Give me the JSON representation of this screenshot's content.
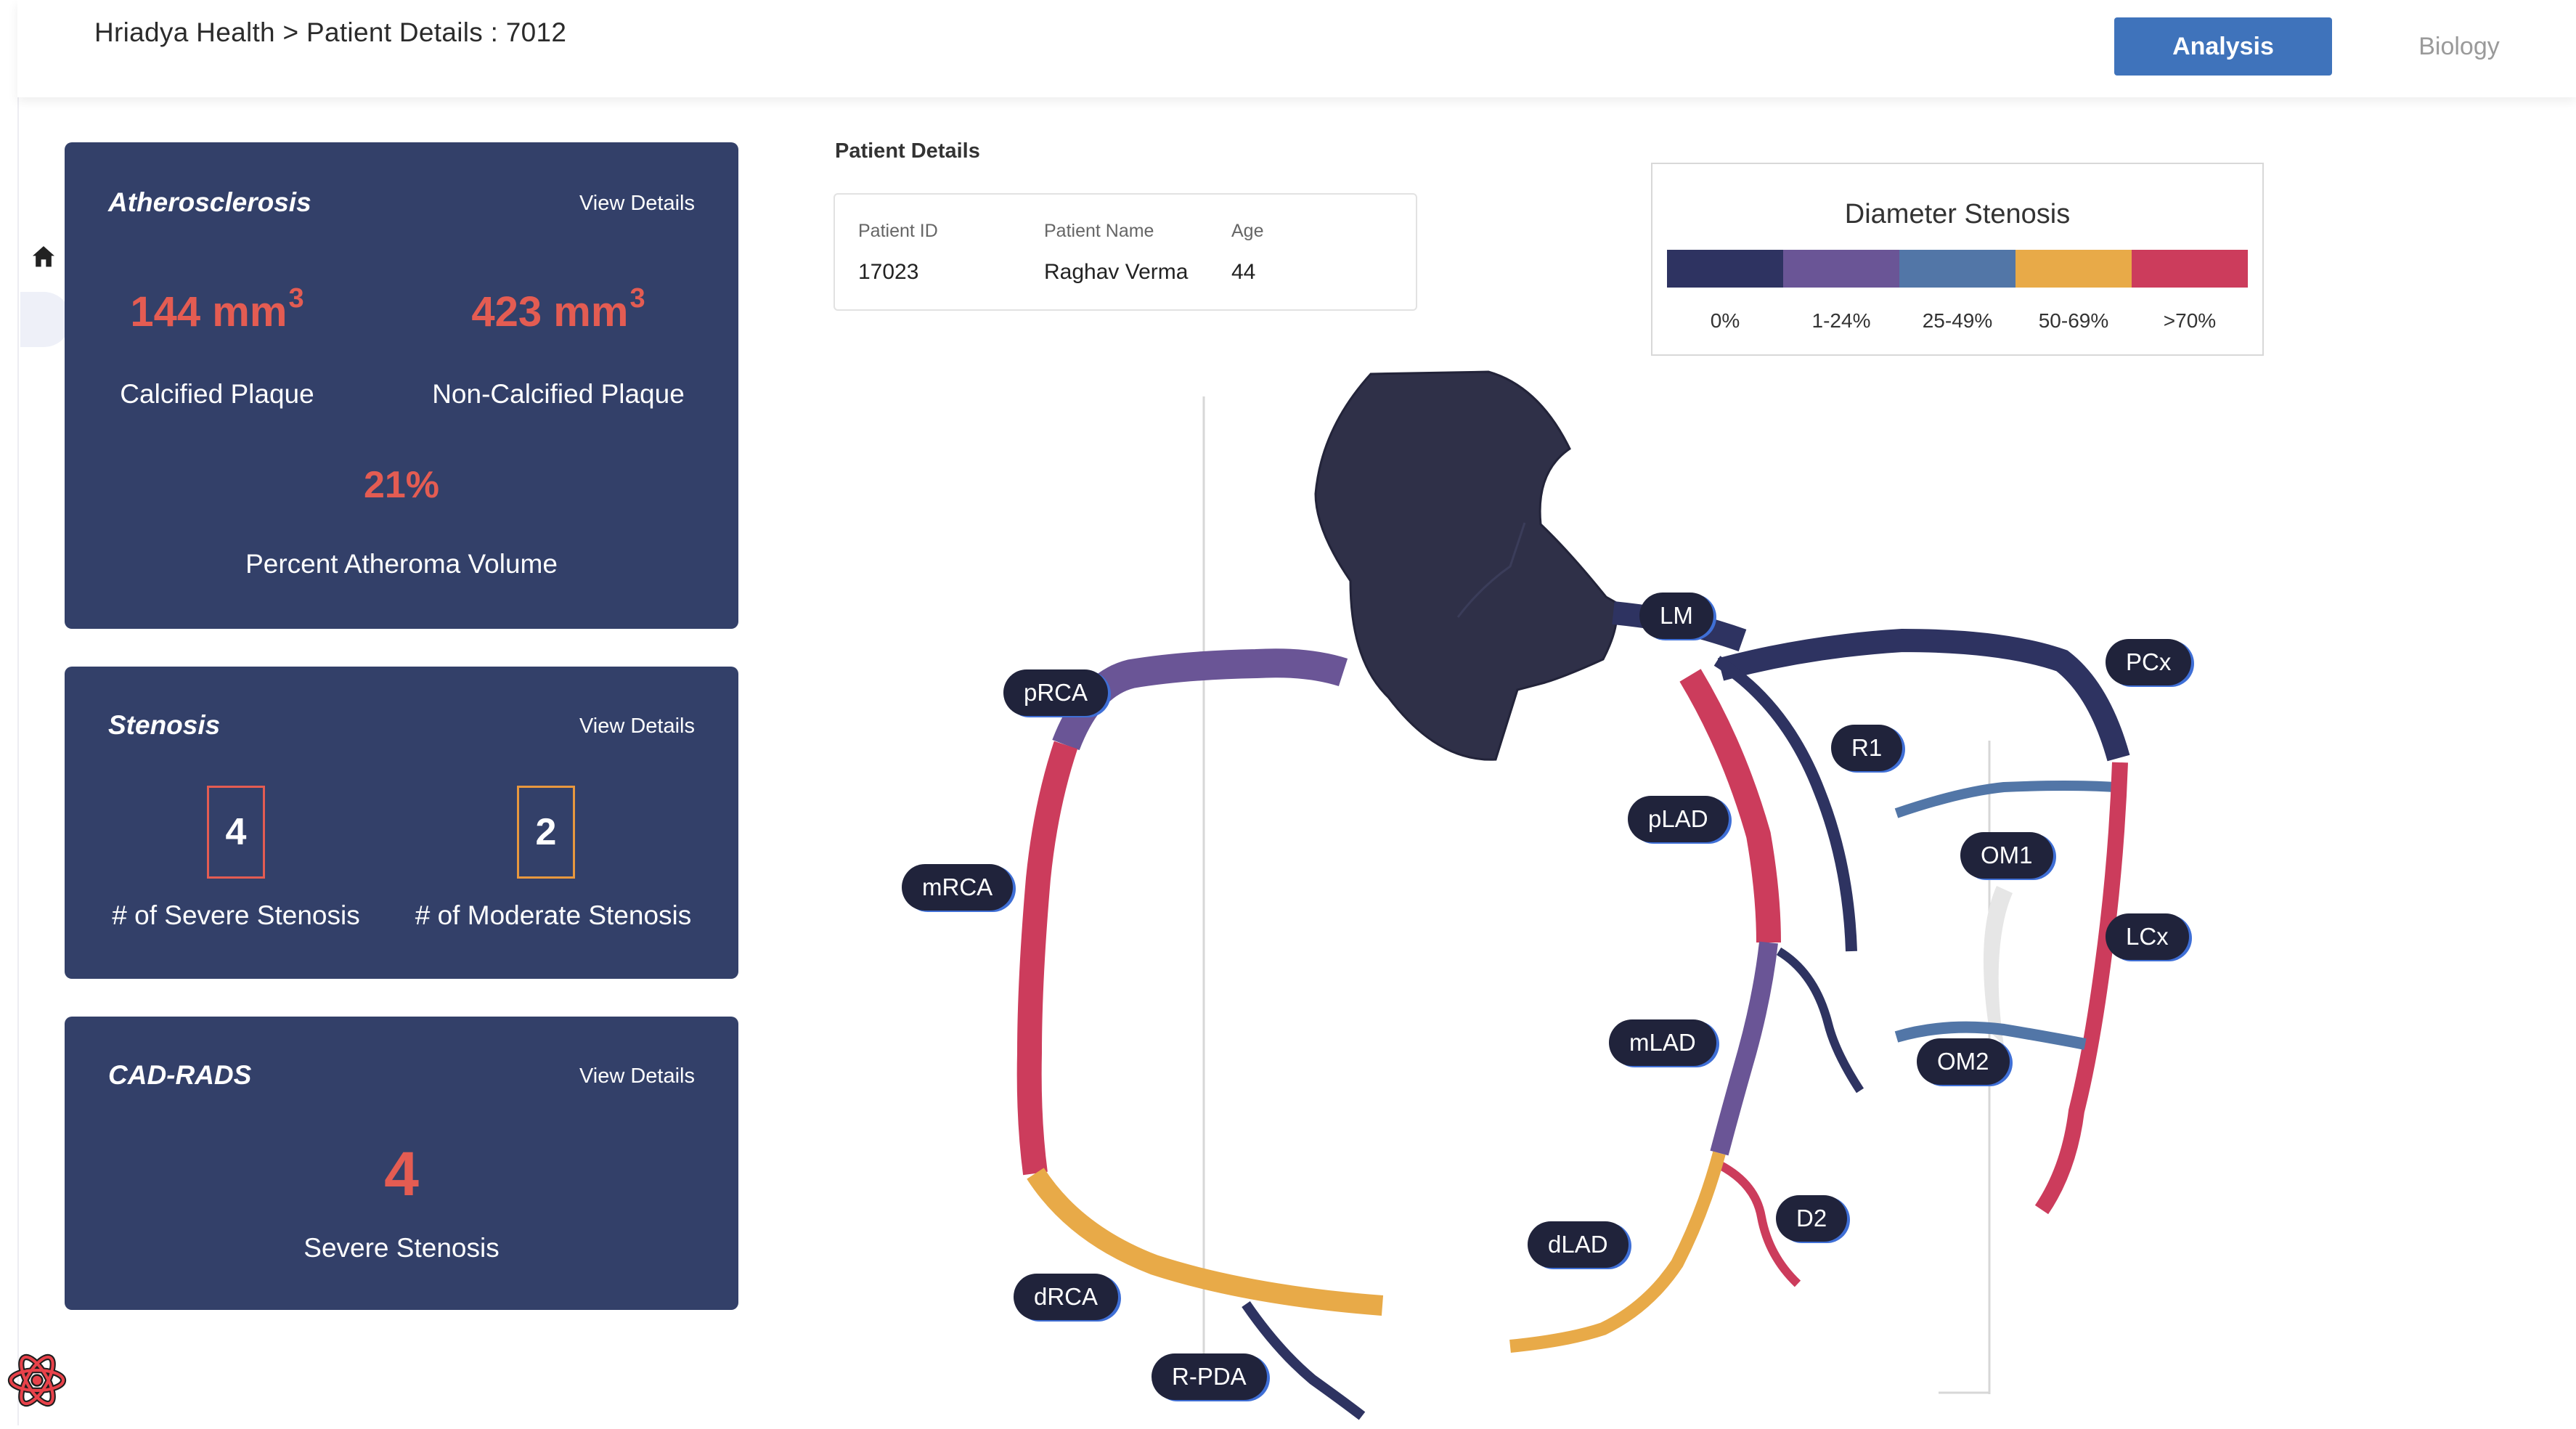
{
  "header": {
    "breadcrumb": "Hriadya Health > Patient Details : 7012",
    "tabs": {
      "analysis": "Analysis",
      "biology": "Biology"
    },
    "active_tab": "Analysis"
  },
  "cards": {
    "atherosclerosis": {
      "title": "Atherosclerosis",
      "view_details": "View Details",
      "calcified_value": "144 mm",
      "calcified_exp": "3",
      "calcified_label": "Calcified Plaque",
      "noncalcified_value": "423 mm",
      "noncalcified_exp": "3",
      "noncalcified_label": "Non-Calcified Plaque",
      "pav_value": "21%",
      "pav_label": "Percent Atheroma Volume"
    },
    "stenosis": {
      "title": "Stenosis",
      "view_details": "View Details",
      "severe_count": "4",
      "severe_label": "# of Severe Stenosis",
      "moderate_count": "2",
      "moderate_label": "# of Moderate Stenosis"
    },
    "cadrads": {
      "title": "CAD-RADS",
      "view_details": "View Details",
      "value": "4",
      "label": "Severe Stenosis"
    }
  },
  "patient": {
    "heading": "Patient Details",
    "id_label": "Patient ID",
    "id_value": "17023",
    "name_label": "Patient Name",
    "name_value": "Raghav Verma",
    "age_label": "Age",
    "age_value": "44"
  },
  "legend": {
    "title": "Diameter Stenosis",
    "items": [
      {
        "label": "0%",
        "color": "#2e3361"
      },
      {
        "label": "1-24%",
        "color": "#6a5596"
      },
      {
        "label": "25-49%",
        "color": "#5276a7"
      },
      {
        "label": "50-69%",
        "color": "#e8aa48"
      },
      {
        "label": ">70%",
        "color": "#cc3c5c"
      }
    ]
  },
  "segments": {
    "LM": "LM",
    "PCx": "PCx",
    "pRCA": "pRCA",
    "R1": "R1",
    "pLAD": "pLAD",
    "OM1": "OM1",
    "mRCA": "mRCA",
    "LCx": "LCx",
    "mLAD": "mLAD",
    "OM2": "OM2",
    "D2": "D2",
    "dLAD": "dLAD",
    "dRCA": "dRCA",
    "RPDA": "R-PDA"
  },
  "colors": {
    "card_bg": "#334069",
    "metric_red": "#e45c52",
    "severe_box_border": "#e45c52",
    "moderate_box_border": "#e8983e",
    "accent_blue": "#3f73bb",
    "aorta": "#2f3048"
  },
  "icons": [
    "home-icon",
    "react-logo-icon"
  ]
}
